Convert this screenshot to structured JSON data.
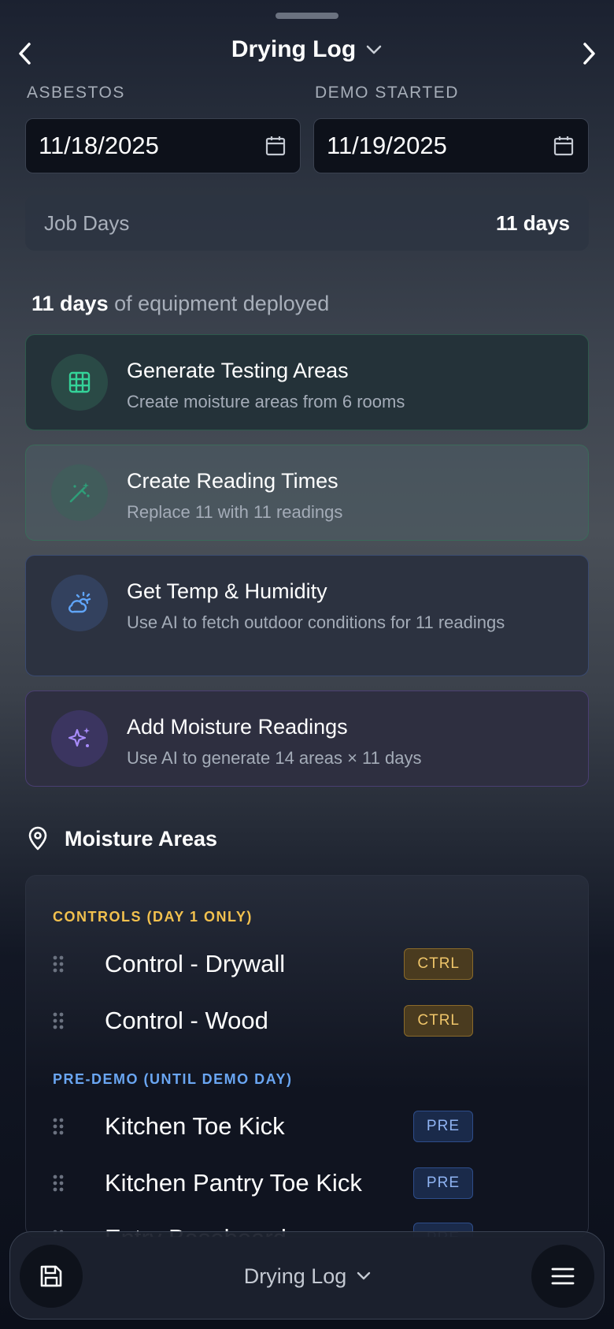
{
  "header": {
    "title": "Drying Log",
    "back_icon": "chevron-left-icon",
    "forward_icon": "chevron-right-icon"
  },
  "dates": {
    "asbestos_label": "ASBESTOS",
    "asbestos_value": "11/18/2025",
    "demo_label": "DEMO STARTED",
    "demo_value": "11/19/2025"
  },
  "job_days": {
    "label": "Job Days",
    "value": "11 days"
  },
  "equipment": {
    "days": "11 days",
    "suffix": " of equipment deployed"
  },
  "actions": [
    {
      "title": "Generate Testing Areas",
      "subtitle": "Create moisture areas from 6 rooms",
      "icon": "grid-icon"
    },
    {
      "title": "Create Reading Times",
      "subtitle": "Replace 11 with 11 readings",
      "icon": "magic-wand-icon"
    },
    {
      "title": "Get Temp & Humidity",
      "subtitle": "Use AI to fetch outdoor conditions for 11 readings",
      "icon": "cloud-sun-icon"
    },
    {
      "title": "Add Moisture Readings",
      "subtitle": "Use AI to generate 14 areas × 11 days",
      "icon": "sparkles-icon"
    }
  ],
  "moisture_areas": {
    "title": "Moisture Areas",
    "groups": [
      {
        "label": "CONTROLS (DAY 1 ONLY)",
        "color": "#f2c14e",
        "items": [
          {
            "name": "Control - Drywall",
            "badge": "CTRL"
          },
          {
            "name": "Control - Wood",
            "badge": "CTRL"
          }
        ]
      },
      {
        "label": "PRE-DEMO (UNTIL DEMO DAY)",
        "color": "#6aa6f2",
        "items": [
          {
            "name": "Kitchen Toe Kick",
            "badge": "PRE"
          },
          {
            "name": "Kitchen Pantry Toe Kick",
            "badge": "PRE"
          },
          {
            "name": "Entry Baseboard",
            "badge": "PRE"
          }
        ]
      }
    ]
  },
  "bottom_bar": {
    "title": "Drying Log",
    "save_icon": "save-icon",
    "menu_icon": "menu-icon"
  }
}
